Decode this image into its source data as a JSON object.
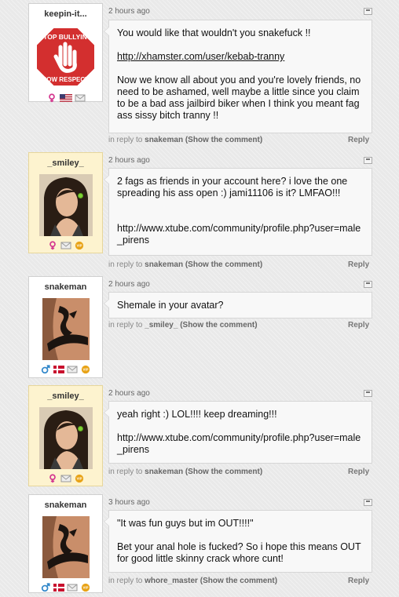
{
  "comments": [
    {
      "username": "keepin-it...",
      "time": "2 hours ago",
      "paragraphs": [
        "You would like that wouldn't you snakefuck !!"
      ],
      "link": "http://xhamster.com/user/kebab-tranny",
      "after": "Now we know all about you and you're lovely friends, no need to be ashamed, well maybe a little since you claim to be a bad ass jailbird biker when I think you meant fag ass sissy bitch tranny !!",
      "reply_prefix": "in reply to",
      "reply_to": "snakeman",
      "show_comment": "(Show the comment)",
      "reply_label": "Reply",
      "avatar_text": [
        "STOP BULLYING",
        "SOW RESPECT"
      ]
    },
    {
      "username": "_smiley_",
      "time": "2 hours ago",
      "body": "2 fags as friends in your account here? i love the one spreading his ass open :) jami11106 is it? LMFAO!!!",
      "url_text": "http://www.xtube.com/community/profile.php?user=male_pirens",
      "reply_prefix": "in reply to",
      "reply_to": "snakeman",
      "show_comment": "(Show the comment)",
      "reply_label": "Reply"
    },
    {
      "username": "snakeman",
      "time": "2 hours ago",
      "body": "Shemale in your avatar?",
      "reply_prefix": "in reply to",
      "reply_to": "_smiley_",
      "show_comment": "(Show the comment)",
      "reply_label": "Reply"
    },
    {
      "username": "_smiley_",
      "time": "2 hours ago",
      "body": "yeah right :) LOL!!!! keep dreaming!!!",
      "url_text": "http://www.xtube.com/community/profile.php?user=male_pirens",
      "reply_prefix": "in reply to",
      "reply_to": "snakeman",
      "show_comment": "(Show the comment)",
      "reply_label": "Reply"
    },
    {
      "username": "snakeman",
      "time": "3 hours ago",
      "body": "\"It was fun guys but im OUT!!!!\"",
      "body2": "Bet your anal hole is fucked? So i hope this means OUT for good little skinny crack whore cunt!",
      "reply_prefix": "in reply to",
      "reply_to": "whore_master",
      "show_comment": "(Show the comment)",
      "reply_label": "Reply"
    }
  ],
  "colors": {
    "female": "#d4378f",
    "male": "#2f86c9",
    "vip": "#e8a317",
    "vip_card": "#fdf3cf"
  },
  "icons": [
    "female-icon",
    "male-icon",
    "flag-us-icon",
    "flag-dk-icon",
    "mail-icon",
    "vip-badge-icon",
    "collapse-icon"
  ]
}
